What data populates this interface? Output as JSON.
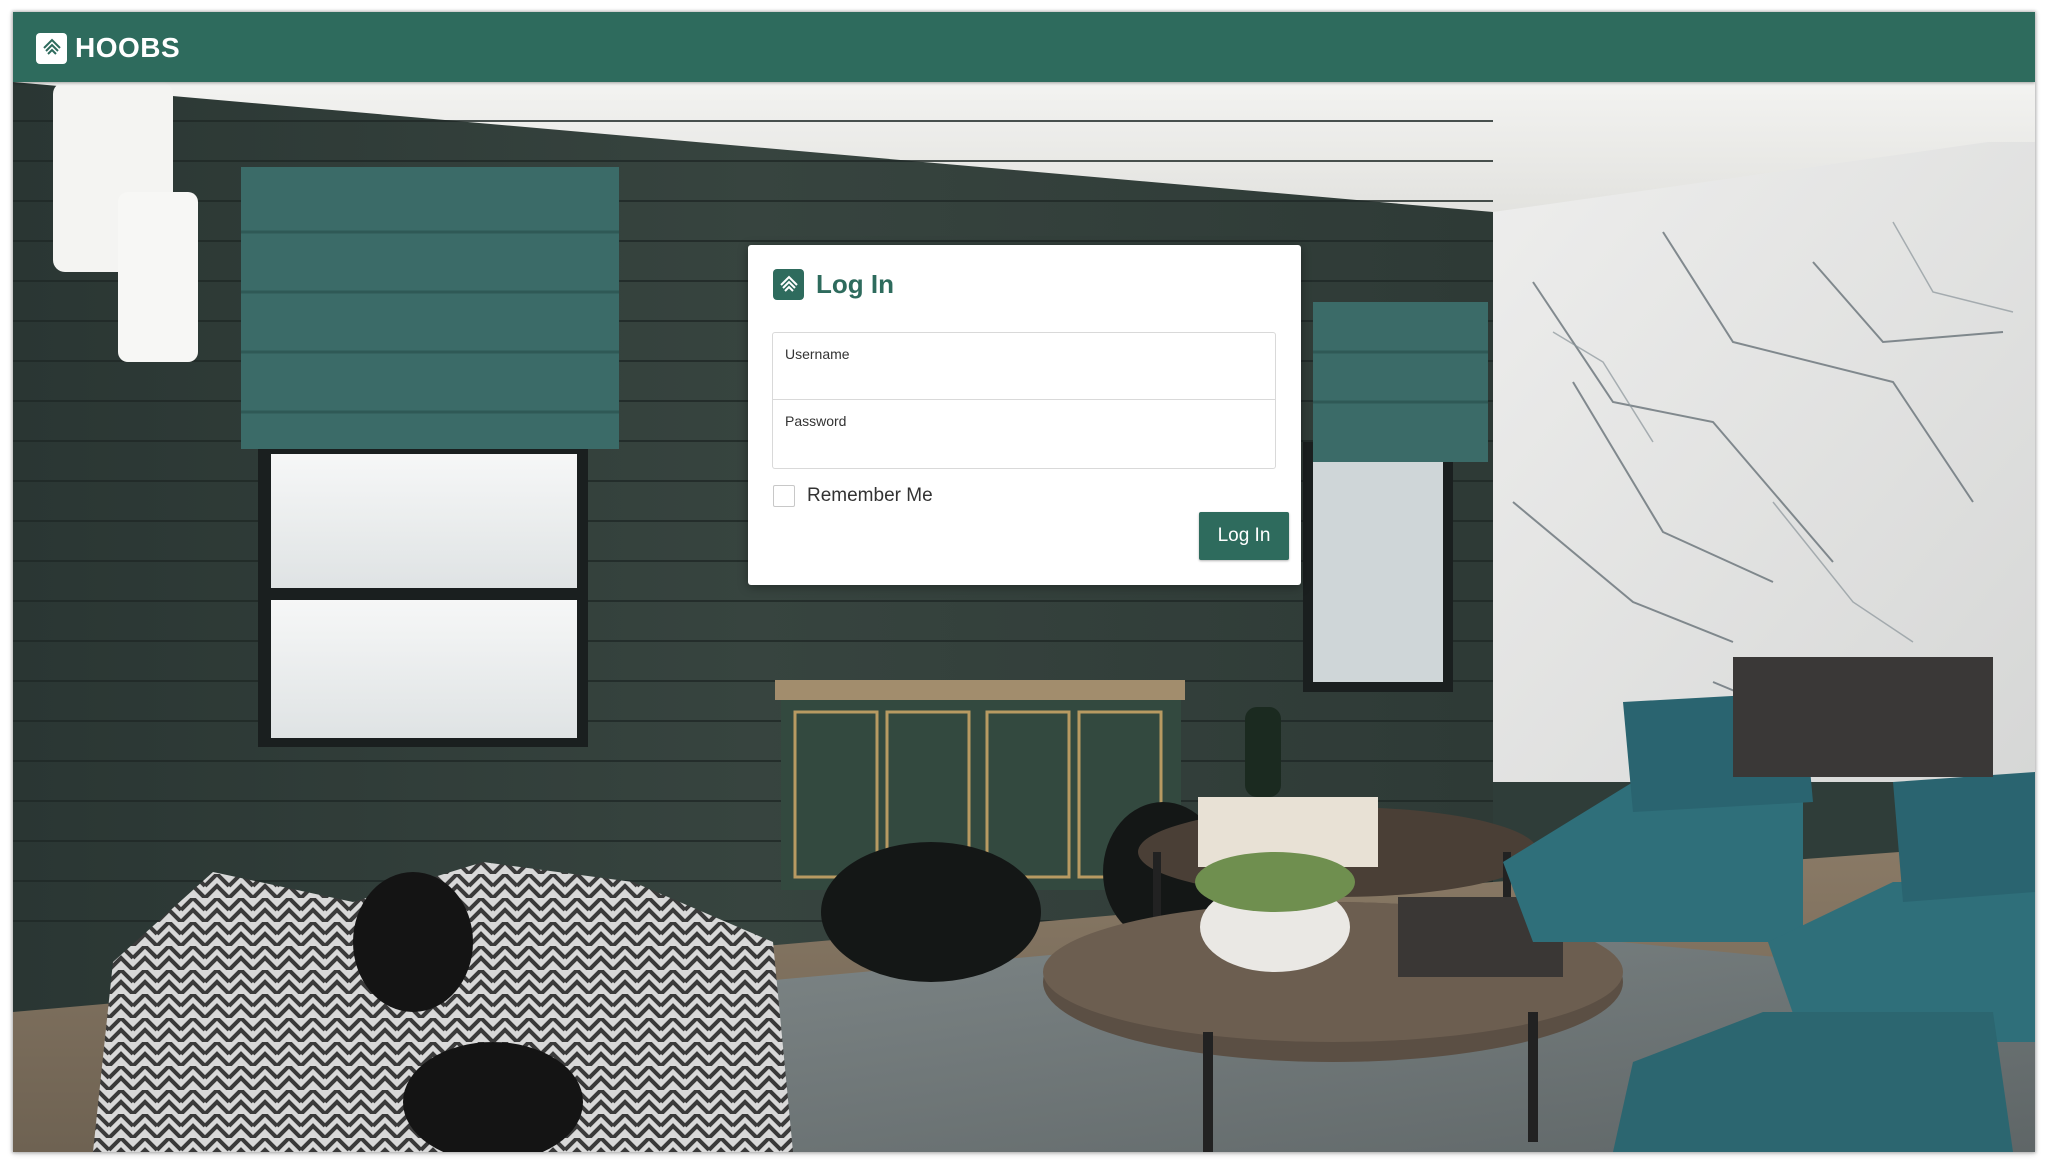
{
  "app": {
    "name": "HOOBS",
    "logo_icon": "hoobs-logo-icon",
    "brand_color": "#2e6b5d"
  },
  "login": {
    "title": "Log In",
    "username_label": "Username",
    "username_value": "",
    "password_label": "Password",
    "password_value": "",
    "remember_label": "Remember Me",
    "remember_checked": false,
    "submit_label": "Log In"
  },
  "background": {
    "description_icon": "living-room-photo"
  }
}
